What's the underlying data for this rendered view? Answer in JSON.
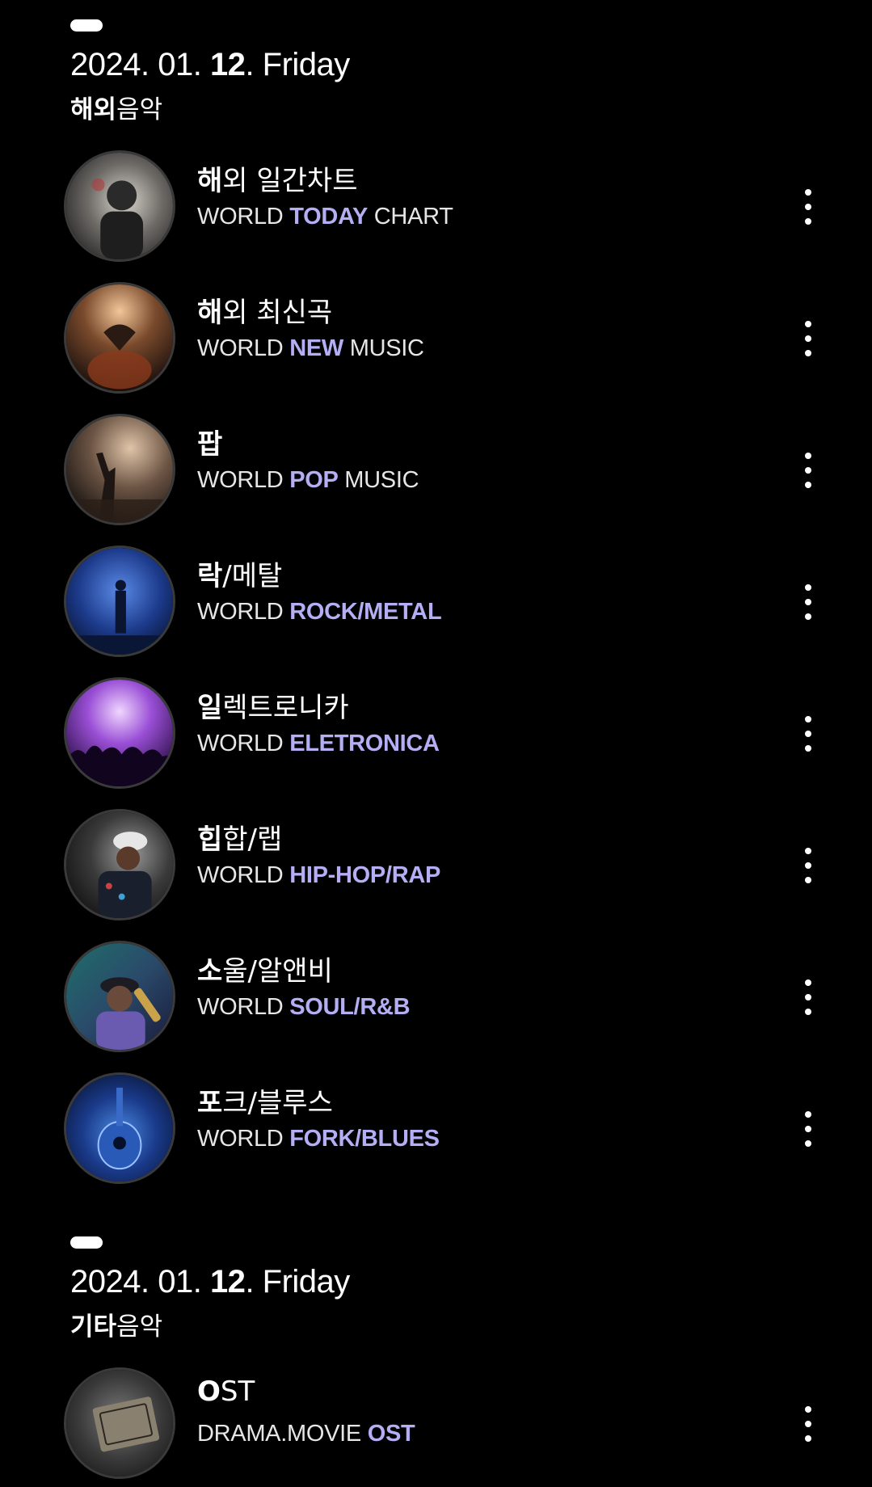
{
  "sections": [
    {
      "date_prefix": "2024. 01. ",
      "date_day": "12",
      "date_suffix": ". Friday",
      "category_bold": "해외",
      "category_rest": "음악",
      "items": [
        {
          "title_bold": "해",
          "title_rest": "외 일간차트",
          "sub_pre": "WORLD ",
          "sub_bold": "TODAY",
          "sub_post": " CHART",
          "image": "headphones-concert-photo"
        },
        {
          "title_bold": "해",
          "title_rest": "외 최신곡",
          "sub_pre": "WORLD ",
          "sub_bold": "NEW",
          "sub_post": " MUSIC",
          "image": "heart-hands-crowd-photo"
        },
        {
          "title_bold": "팝",
          "title_rest": "",
          "sub_pre": "WORLD ",
          "sub_bold": "POP",
          "sub_post": " MUSIC",
          "image": "raised-hand-concert-photo"
        },
        {
          "title_bold": "락",
          "title_rest": "/메탈",
          "sub_pre": "WORLD ",
          "sub_bold": "ROCK/METAL",
          "sub_post": "",
          "image": "rock-stage-blue-photo"
        },
        {
          "title_bold": "일",
          "title_rest": "렉트로니카",
          "sub_pre": "WORLD ",
          "sub_bold": "ELETRONICA",
          "sub_post": "",
          "image": "purple-crowd-photo"
        },
        {
          "title_bold": "힙",
          "title_rest": "합/랩",
          "sub_pre": "WORLD ",
          "sub_bold": "HIP-HOP/RAP",
          "sub_post": "",
          "image": "rapper-cap-photo"
        },
        {
          "title_bold": "소",
          "title_rest": "울/알앤비",
          "sub_pre": "WORLD ",
          "sub_bold": "SOUL/R&B",
          "sub_post": "",
          "image": "saxophone-player-photo"
        },
        {
          "title_bold": "포",
          "title_rest": "크/블루스",
          "sub_pre": "WORLD ",
          "sub_bold": "FORK/BLUES",
          "sub_post": "",
          "image": "blue-guitar-photo"
        }
      ]
    },
    {
      "date_prefix": "2024. 01. ",
      "date_day": "12",
      "date_suffix": ". Friday",
      "category_bold": "기타",
      "category_rest": "음악",
      "items": [
        {
          "title_bold": "O",
          "title_rest": "ST",
          "sub_pre": "DRAMA.MOVIE ",
          "sub_bold": "OST",
          "sub_post": "",
          "image": "movie-ticket-photo"
        }
      ]
    }
  ],
  "colors": {
    "accent": "#b4aef5",
    "background": "#000000",
    "text": "#ffffff"
  },
  "icons": {
    "more": "more-vertical-icon"
  }
}
